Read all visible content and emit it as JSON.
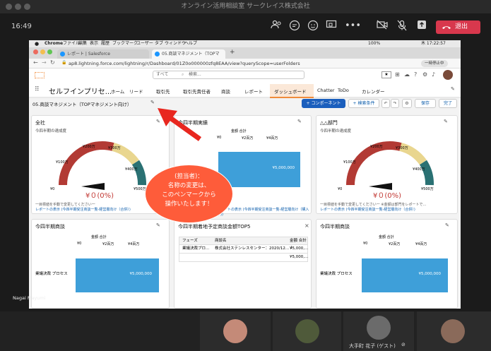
{
  "meeting": {
    "window_title": "オンライン活用相談室 サークレイス株式会社",
    "time": "16:49",
    "leave_label": "退出",
    "presenter_label": "Nagai Mayumi",
    "participant_name": "大手町 花子 (ゲスト)"
  },
  "mac_menu": {
    "apple": "",
    "items": [
      "Chrome",
      "ファイル",
      "編集",
      "表示",
      "履歴",
      "ブックマーク",
      "ユーザー",
      "タブ",
      "ウィンドウ",
      "ヘルプ"
    ],
    "status": "100%",
    "clock": "木 17:22:57"
  },
  "browser": {
    "tabs": [
      {
        "label": "レポート | Salesforce"
      },
      {
        "label": "05.商談マネジメント（TOPマネ..."
      }
    ],
    "new_tab": "+",
    "url": "ap8.lightning.force.com/lightning/r/Dashboard/01Z0o000000zfq8EAA/view?queryScope=userFolders",
    "profile": "一時停止中"
  },
  "sf": {
    "search_scope": "すべて",
    "search_placeholder": "検索...",
    "app_name": "セルフインプリセ...",
    "nav": [
      "ホーム",
      "リード",
      "取引先",
      "取引先責任者",
      "商談",
      "レポート",
      "ダッシュボード",
      "Chatter",
      "ToDo",
      "カレンダー"
    ],
    "dashboard_name": "05.商談マネジメント（TOPマネジメント向け）",
    "buttons": {
      "component": "+ コンポーネント",
      "filter": "+ 検索条件",
      "save": "保存",
      "done": "完了"
    }
  },
  "cards": {
    "c1": {
      "title": "全社",
      "sub": "今四半期の達成度",
      "value": "¥０(0%)",
      "foot1": "一目標値を手動で変更してください一",
      "foot2": "レポートの表示 (今四半期受注商談一覧-経営層向け（合併）)",
      "labels": [
        "¥0",
        "¥100万",
        "¥200万",
        "¥300万",
        "¥400万",
        "¥500万"
      ]
    },
    "c2": {
      "title": "今四半期実績",
      "axis_title": "金額 合計",
      "ticks": [
        "¥0",
        "¥2百万",
        "¥4百万"
      ],
      "bar_label": "¥5,000,000",
      "foot": "レポートの表示 (今四半期受注商談一覧-経営層向け（購入中))"
    },
    "c3": {
      "title": "△△部門",
      "sub": "今四半期の達成度",
      "value": "¥０(0%)",
      "foot1": "一目標値を手動で変更してください一 ※金額は部門をレポートで...",
      "foot2": "レポートの表示 (今四半期受注商談一覧-経営層向け（合併）)",
      "labels": [
        "¥0",
        "¥100万",
        "¥200万",
        "¥300万",
        "¥400万",
        "¥500万"
      ]
    },
    "c4": {
      "title": "今四半期商談",
      "axis_title": "金額 合計",
      "ticks": [
        "¥0",
        "¥2百万",
        "¥4百万"
      ],
      "category": "業議決裁 プロセス",
      "bar_label": "¥5,000,000"
    },
    "c5": {
      "title": "今四半期着地予定商談金額TOP5",
      "headers": [
        "フェーズ",
        "商談名",
        "金額 合計 ↓"
      ],
      "rows": [
        [
          "業議決裁プロ...",
          "株式会社ステンレスセンター：2020/12...",
          "¥5,000,..."
        ],
        [
          "",
          "",
          "¥5,000,..."
        ]
      ]
    },
    "c6": {
      "title": "今四半期商談",
      "axis_title": "金額 合計",
      "ticks": [
        "¥0",
        "¥2百万",
        "¥4百万"
      ],
      "category": "業議決裁 プロセス",
      "bar_label": "¥5,000,000"
    }
  },
  "callout": {
    "line1": "(担当者)：",
    "line2": "名称の変更は、",
    "line3": "このペンマークから",
    "line4": "操作いたします！"
  },
  "colors": {
    "gauge_red": "#b23a34",
    "gauge_yellow": "#e9d68f",
    "gauge_green": "#2a7173",
    "bar_blue": "#3e9fd9",
    "accent_orange": "#f08b3b",
    "leave_red": "#d8384d"
  }
}
